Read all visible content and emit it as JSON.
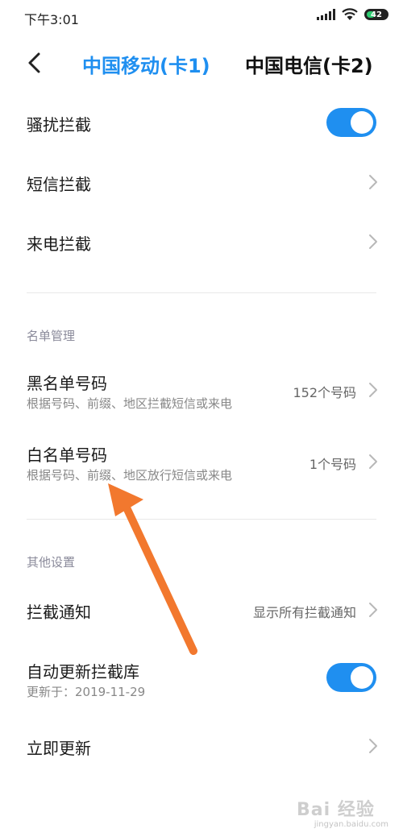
{
  "status_bar": {
    "time": "下午3:01",
    "battery": "42"
  },
  "tabs": [
    {
      "label": "中国移动(卡1)",
      "active": true
    },
    {
      "label": "中国电信(卡2)",
      "active": false
    }
  ],
  "accent_color": "#1f8ff0",
  "annotation_color": "#f2782e",
  "settings": {
    "harass_block": {
      "title": "骚扰拦截",
      "enabled": true
    },
    "sms_block": {
      "title": "短信拦截"
    },
    "call_block": {
      "title": "来电拦截"
    }
  },
  "list_management": {
    "header": "名单管理",
    "blacklist": {
      "title": "黑名单号码",
      "subtitle": "根据号码、前缀、地区拦截短信或来电",
      "value": "152个号码"
    },
    "whitelist": {
      "title": "白名单号码",
      "subtitle": "根据号码、前缀、地区放行短信或来电",
      "value": "1个号码"
    }
  },
  "other_settings": {
    "header": "其他设置",
    "notify": {
      "title": "拦截通知",
      "value": "显示所有拦截通知"
    },
    "auto_update": {
      "title": "自动更新拦截库",
      "subtitle": "更新于：2019-11-29",
      "enabled": true
    },
    "update_now": {
      "title": "立即更新"
    }
  },
  "watermark": {
    "main": "Bai 经验",
    "sub": "jingyan.baidu.com"
  }
}
